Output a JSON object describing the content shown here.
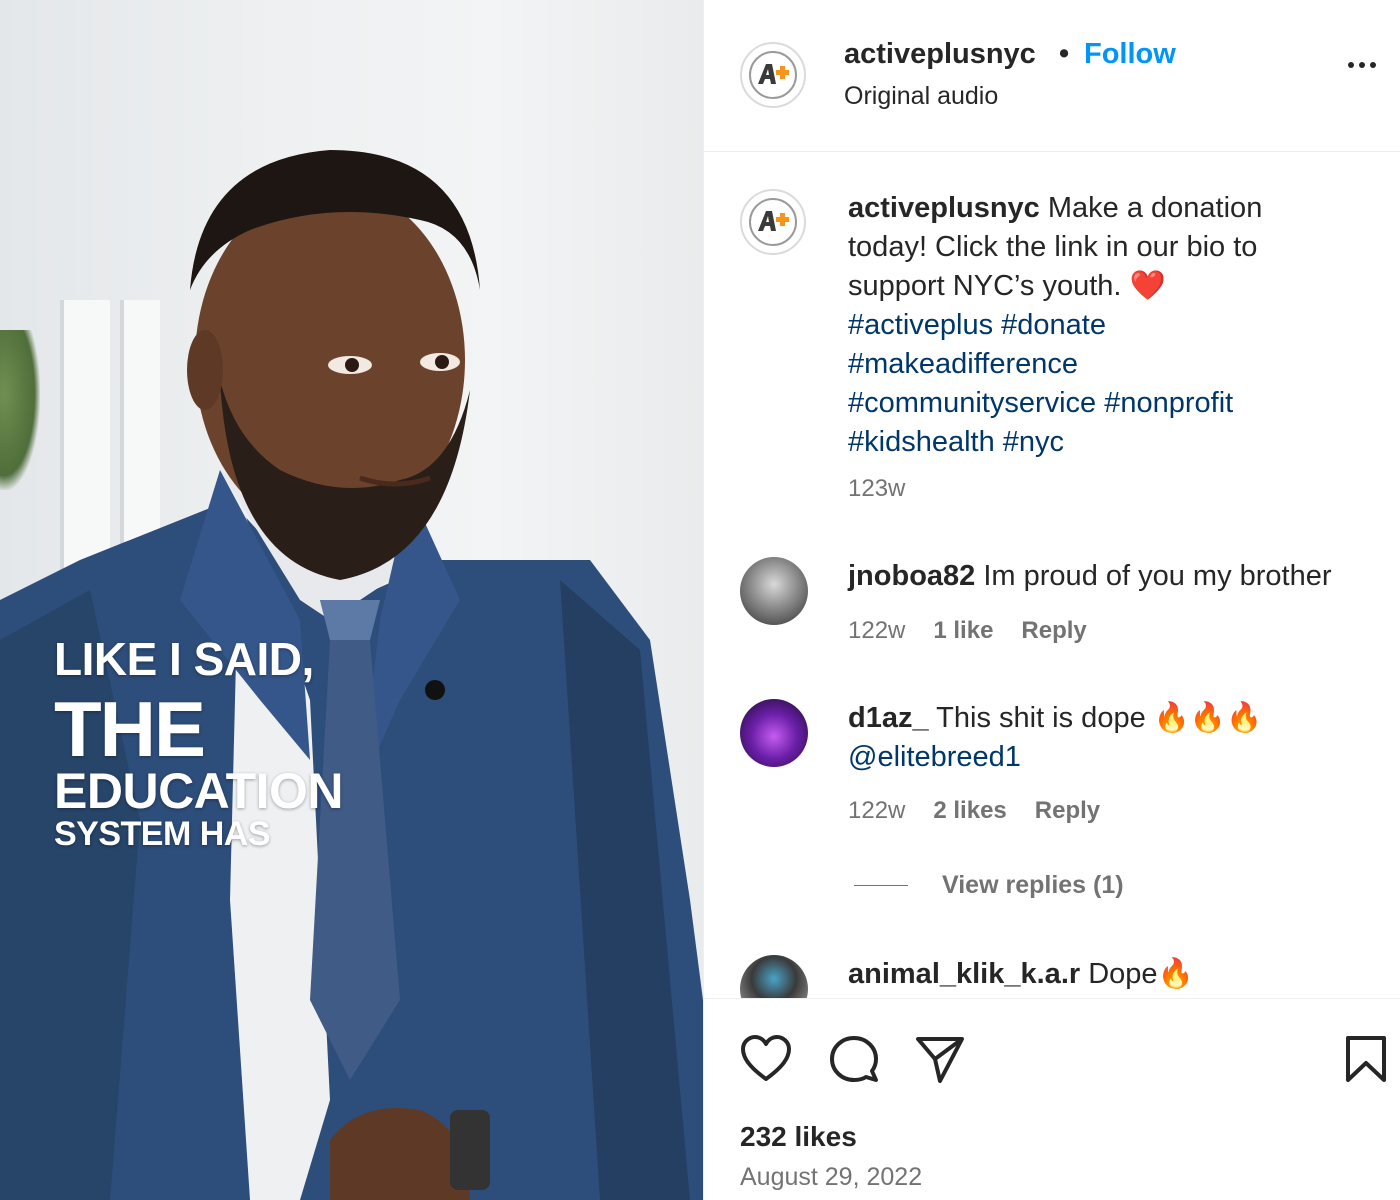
{
  "colors": {
    "accent": "#0095f6",
    "link": "#00376b",
    "muted": "#737373",
    "logo_orange": "#f7941d"
  },
  "video": {
    "overlay_lines": [
      "LIKE I SAID,",
      "THE",
      "EDUCATION",
      "SYSTEM HAS"
    ]
  },
  "header": {
    "username": "activeplusnyc",
    "separator": "•",
    "follow_label": "Follow",
    "audio": "Original audio",
    "avatar_text": "A+"
  },
  "caption": {
    "username": "activeplusnyc",
    "text": "Make a donation today! Click the link in our bio to support NYC’s youth. ❤️",
    "hashtags": "#activeplus #donate #makeadifference #communityservice #nonprofit #kidshealth #nyc",
    "time": "123w"
  },
  "comments": [
    {
      "username": "jnoboa82",
      "text": "Im proud of you my brother",
      "time": "122w",
      "likes": "1 like",
      "reply": "Reply"
    },
    {
      "username": "d1az_",
      "text": "This shit is dope 🔥🔥🔥",
      "mention": "@elitebreed1",
      "time": "122w",
      "likes": "2 likes",
      "reply": "Reply",
      "view_replies": "View replies (1)"
    },
    {
      "username": "animal_klik_k.a.r",
      "text": "Dope🔥"
    }
  ],
  "footer": {
    "likes": "232 likes",
    "date": "August 29, 2022"
  }
}
